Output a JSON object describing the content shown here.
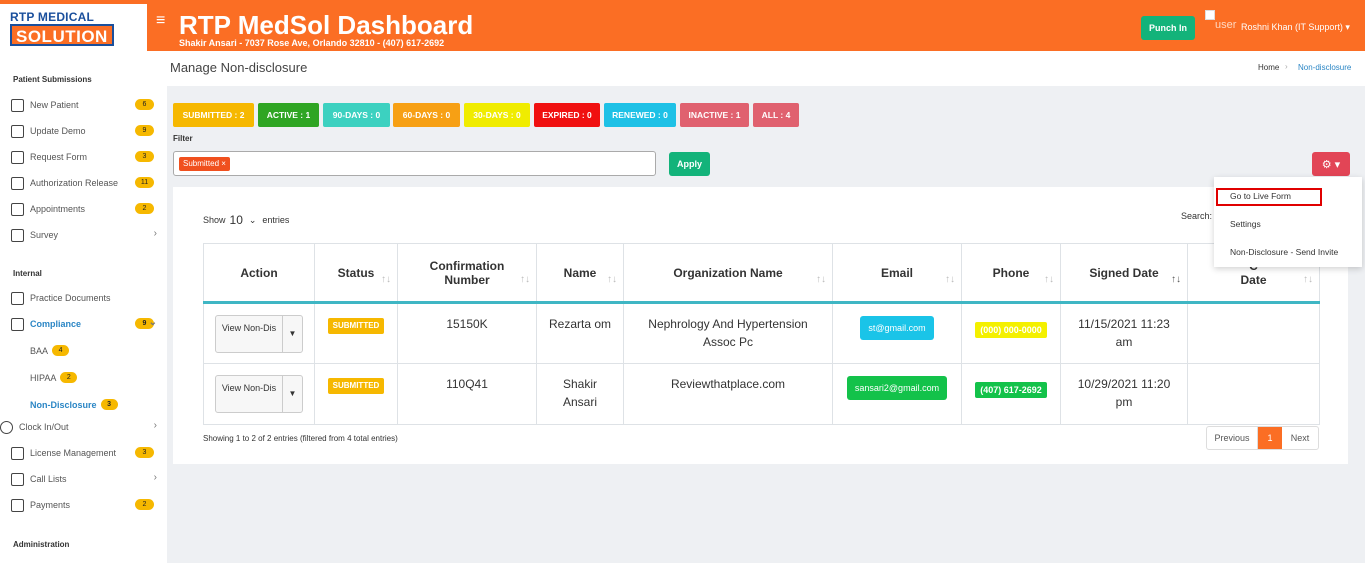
{
  "header": {
    "logo_top": "RTP MEDICAL",
    "logo_bottom": "SOLUTION",
    "menu_icon": "hamburger-icon",
    "title": "RTP MedSol Dashboard",
    "subtitle": "Shakir Ansari - 7037 Rose Ave, Orlando 32810 - (407) 617-2692",
    "punch_label": "Punch In",
    "user_label": "user",
    "user_name": "Roshni Khan (IT Support) ▾"
  },
  "sidebar": {
    "section1": "Patient Submissions",
    "items1": [
      {
        "label": "New Patient",
        "badge": "6"
      },
      {
        "label": "Update Demo",
        "badge": "9"
      },
      {
        "label": "Request Form",
        "badge": "3"
      },
      {
        "label": "Authorization Release",
        "badge": "11"
      },
      {
        "label": "Appointments",
        "badge": "2"
      },
      {
        "label": "Survey",
        "arrow": "›"
      }
    ],
    "section2": "Internal",
    "items2": [
      {
        "label": "Practice Documents"
      },
      {
        "label": "Compliance",
        "badge": "9",
        "arrow": "⌄"
      },
      {
        "label": "BAA",
        "badge": "4"
      },
      {
        "label": "HIPAA",
        "badge": "2"
      },
      {
        "label": "Non-Disclosure",
        "badge": "3"
      },
      {
        "label": "Clock In/Out",
        "arrow": "›"
      },
      {
        "label": "License Management",
        "badge": "3"
      },
      {
        "label": "Call Lists",
        "arrow": "›"
      },
      {
        "label": "Payments",
        "badge": "2"
      }
    ],
    "section3": "Administration"
  },
  "breadcrumb": {
    "page_title": "Manage Non-disclosure",
    "home": "Home",
    "separator": "›",
    "current": "Non-disclosure"
  },
  "tabs": [
    {
      "label": "SUBMITTED : 2",
      "color": "#f6b800"
    },
    {
      "label": "ACTIVE : 1",
      "color": "#2fa523"
    },
    {
      "label": "90-DAYS : 0",
      "color": "#3cd1c0"
    },
    {
      "label": "60-DAYS : 0",
      "color": "#f7a014"
    },
    {
      "label": "30-DAYS : 0",
      "color": "#f0ec00"
    },
    {
      "label": "EXPIRED : 0",
      "color": "#f01010"
    },
    {
      "label": "RENEWED : 0",
      "color": "#1ec1e6"
    },
    {
      "label": "INACTIVE : 1",
      "color": "#e0616f"
    },
    {
      "label": "ALL : 4",
      "color": "#e0616f"
    }
  ],
  "filter": {
    "label": "Filter",
    "chip": "Submitted ×",
    "apply_label": "Apply",
    "gear_label": "⚙ ▾"
  },
  "table_controls": {
    "show": "Show",
    "entries_value": "10",
    "entries": "entries",
    "search": "Search:"
  },
  "table": {
    "headers": [
      "Action",
      "Status",
      "Confirmation Number",
      "Name",
      "Organization Name",
      "Email",
      "Phone",
      "Signed Date",
      "C Date"
    ],
    "rows": [
      {
        "action": "View Non-Dis",
        "status": "SUBMITTED",
        "confirmation": "15150K",
        "name": "Rezarta om",
        "organization": "Nephrology And Hypertension Assoc Pc",
        "email": "st@gmail.com",
        "phone": "(000) 000-0000",
        "signed": "11/15/2021 11:23 am"
      },
      {
        "action": "View Non-Dis",
        "status": "SUBMITTED",
        "confirmation": "110Q41",
        "name": "Shakir Ansari",
        "organization": "Reviewthatplace.com",
        "email": "sansari2@gmail.com",
        "phone": "(407) 617-2692",
        "signed": "10/29/2021 11:20 pm"
      }
    ],
    "info": "Showing 1 to 2 of 2 entries (filtered from 4 total entries)",
    "pager": {
      "prev": "Previous",
      "current": "1",
      "next": "Next"
    }
  },
  "menu": {
    "items": [
      "Go to Live Form",
      "Settings",
      "Non-Disclosure - Send Invite"
    ]
  }
}
